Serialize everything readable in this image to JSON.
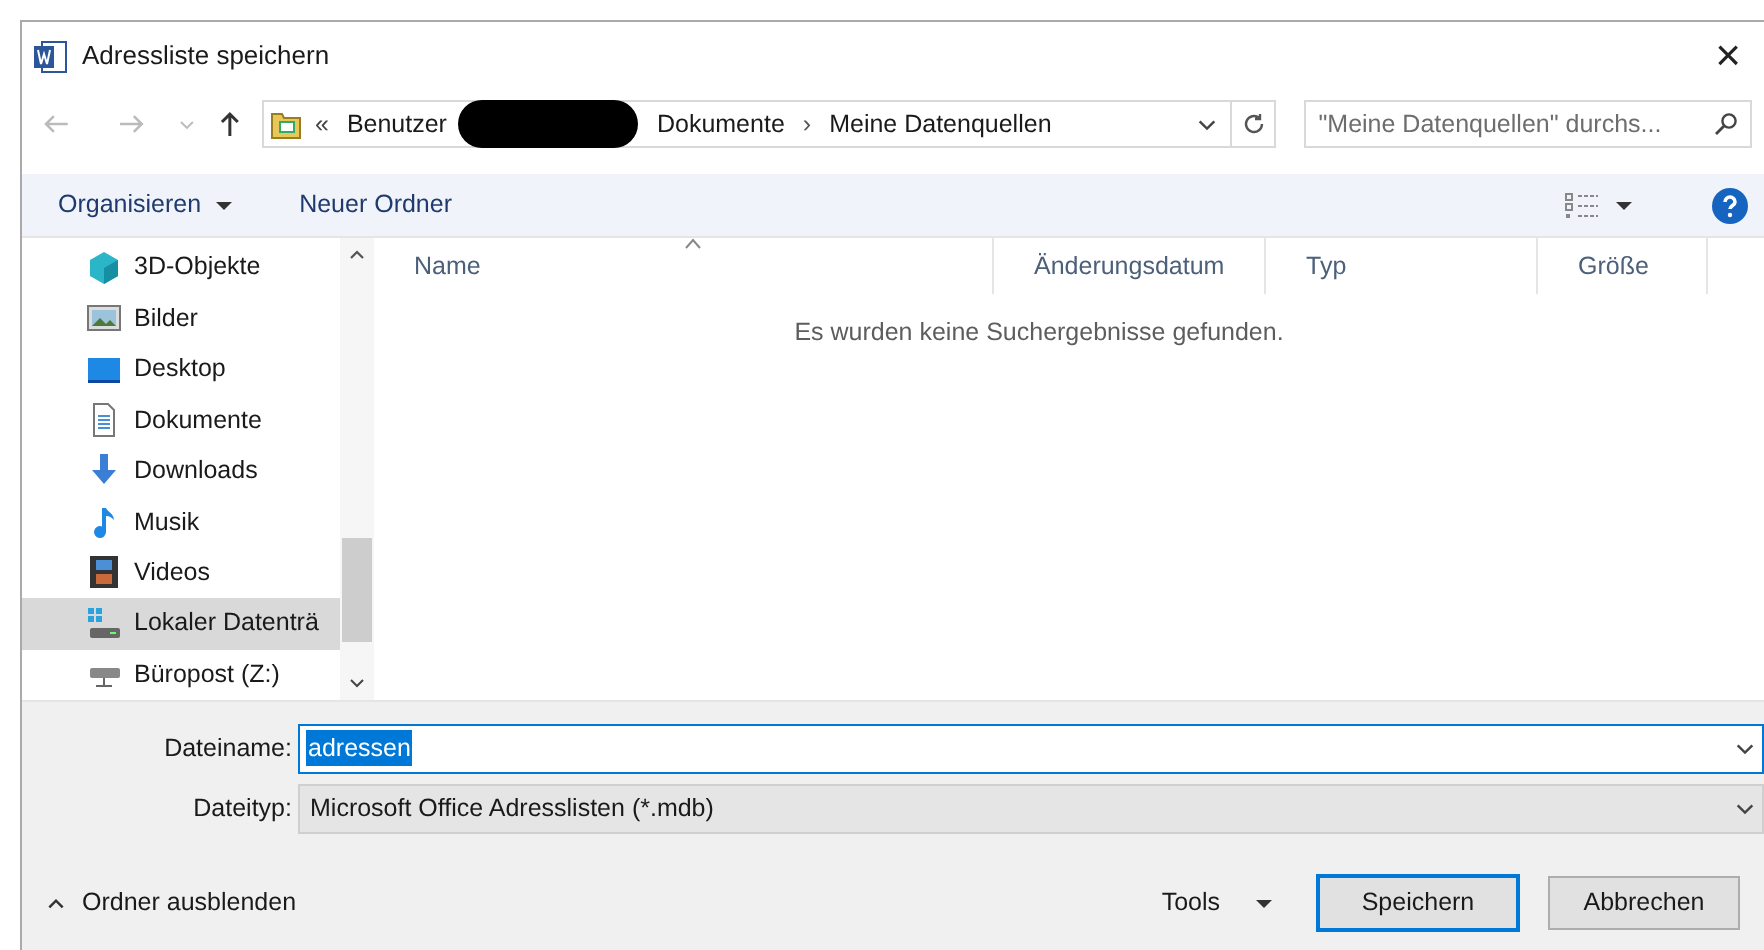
{
  "window": {
    "title": "Adressliste speichern",
    "close": "×"
  },
  "address_bar": {
    "prefix": "«",
    "crumbs": [
      {
        "label": "Benutzer",
        "redacted": false
      },
      {
        "redacted": true
      },
      {
        "label": "Dokumente",
        "redacted": false
      },
      {
        "label": "Meine Datenquellen",
        "redacted": false
      }
    ],
    "separator": "›"
  },
  "search": {
    "placeholder": "\"Meine Datenquellen\" durchs..."
  },
  "toolbar": {
    "organize": "Organisieren",
    "new_folder": "Neuer Ordner"
  },
  "sidebar": {
    "items": [
      {
        "label": "3D-Objekte",
        "kind": "cube",
        "selected": false
      },
      {
        "label": "Bilder",
        "kind": "pictures",
        "selected": false
      },
      {
        "label": "Desktop",
        "kind": "desktop",
        "selected": false
      },
      {
        "label": "Dokumente",
        "kind": "document",
        "selected": false
      },
      {
        "label": "Downloads",
        "kind": "download",
        "selected": false
      },
      {
        "label": "Musik",
        "kind": "music",
        "selected": false
      },
      {
        "label": "Videos",
        "kind": "video",
        "selected": false
      },
      {
        "label": "Lokaler Datenträ",
        "kind": "drive",
        "selected": true
      },
      {
        "label": "Büropost (Z:)",
        "kind": "netdrive",
        "selected": false
      }
    ]
  },
  "table": {
    "columns": [
      "Name",
      "Änderungsdatum",
      "Typ",
      "Größe"
    ],
    "empty_message": "Es wurden keine Suchergebnisse gefunden."
  },
  "filename": {
    "label": "Dateiname:",
    "value": "adressen"
  },
  "filetype": {
    "label": "Dateityp:",
    "value": "Microsoft Office Adresslisten (*.mdb)"
  },
  "footer": {
    "hide_folders": "Ordner ausblenden",
    "tools": "Tools",
    "save": "Speichern",
    "cancel": "Abbrechen"
  }
}
